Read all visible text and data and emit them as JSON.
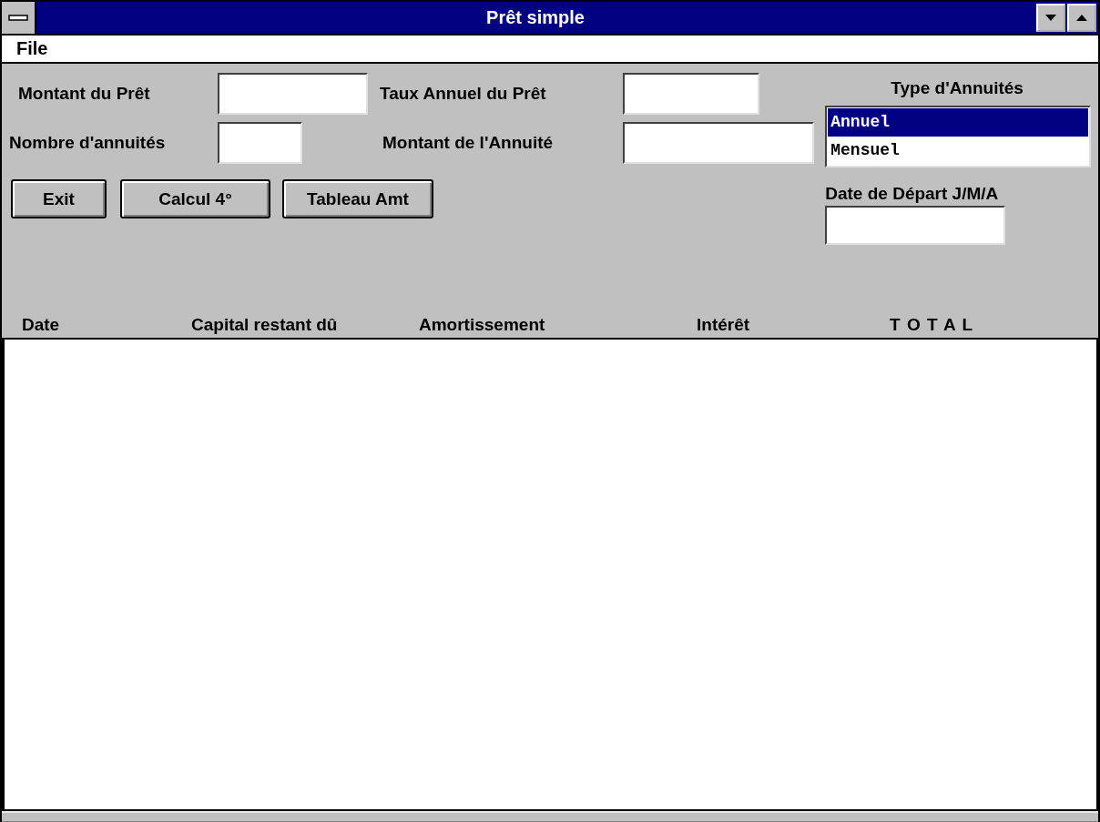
{
  "window": {
    "title": "Prêt simple"
  },
  "menu": [
    "File"
  ],
  "fields": [
    {
      "label": "Montant du Prêt"
    },
    {
      "label": "Taux Annuel du Prêt"
    },
    {
      "label": "Nombre d'annuités"
    },
    {
      "label": "Montant de l'Annuité"
    }
  ],
  "buttons": [
    "Exit",
    "Calcul 4°",
    "Tableau Amt"
  ],
  "annuity_type": {
    "label": "Type d'Annuités",
    "options": [
      {
        "label": "Annuel",
        "selected": true
      },
      {
        "label": "Mensuel",
        "selected": false
      }
    ]
  },
  "start_date": {
    "label": "Date de Départ J/M/A"
  },
  "table": {
    "columns": [
      "Date",
      "Capital restant dû",
      "Amortissement",
      "Intérêt",
      "T O T A L"
    ]
  }
}
